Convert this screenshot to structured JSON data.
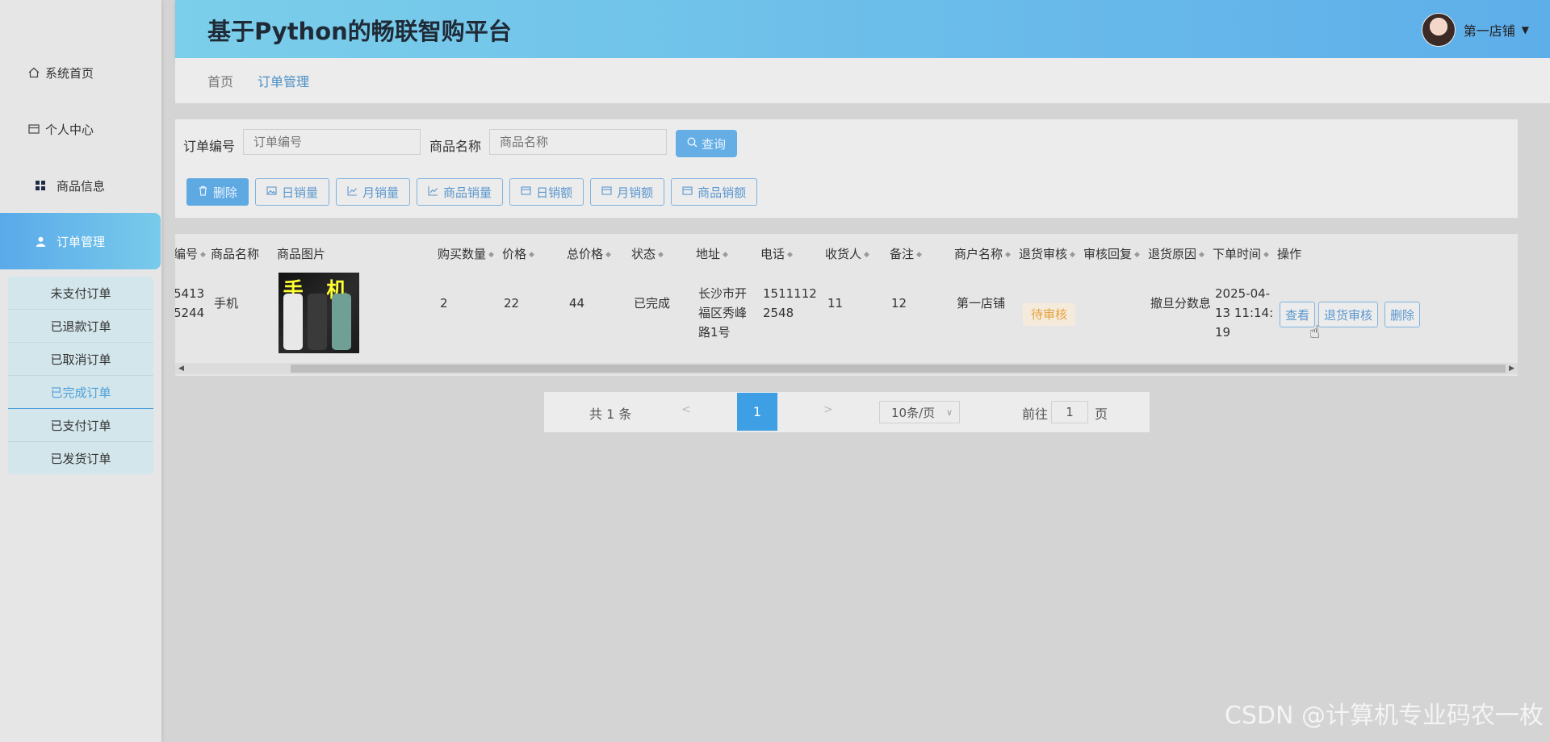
{
  "app": {
    "title": "基于Python的畅联智购平台",
    "user": "第一店铺"
  },
  "sidebar": {
    "items": [
      {
        "label": "系统首页",
        "icon": "home-icon"
      },
      {
        "label": "个人中心",
        "icon": "profile-card-icon"
      },
      {
        "label": "商品信息",
        "icon": "grid-icon"
      },
      {
        "label": "订单管理",
        "icon": "user-icon"
      }
    ],
    "subitems": [
      "未支付订单",
      "已退款订单",
      "已取消订单",
      "已完成订单",
      "已支付订单",
      "已发货订单"
    ]
  },
  "breadcrumb": {
    "home": "首页",
    "current": "订单管理"
  },
  "search": {
    "order_no_label": "订单编号",
    "order_no_placeholder": "订单编号",
    "product_label": "商品名称",
    "product_placeholder": "商品名称",
    "query_label": "查询"
  },
  "toolbar": [
    "删除",
    "日销量",
    "月销量",
    "商品销量",
    "日销额",
    "月销额",
    "商品销额"
  ],
  "table": {
    "headers": [
      "编号",
      "商品名称",
      "商品图片",
      "购买数量",
      "价格",
      "总价格",
      "状态",
      "地址",
      "电话",
      "收货人",
      "备注",
      "商户名称",
      "退货审核",
      "审核回复",
      "退货原因",
      "下单时间",
      "操作"
    ],
    "row": {
      "order_no_l1": "5413",
      "order_no_l2": "5244",
      "product": "手机",
      "image_text": "手 机",
      "qty": "2",
      "price": "22",
      "total": "44",
      "status": "已完成",
      "address_l1": "长沙市开",
      "address_l2": "福区秀峰",
      "address_l3": "路1号",
      "phone_l1": "1511112",
      "phone_l2": "2548",
      "receiver": "11",
      "note": "12",
      "merchant": "第一店铺",
      "return_review": "待审核",
      "return_reason": "撤旦分数息",
      "time_l1": "2025-04-",
      "time_l2": "13 11:14:",
      "time_l3": "19",
      "actions": [
        "查看",
        "退货审核",
        "删除"
      ]
    }
  },
  "pager": {
    "total": "共 1 条",
    "prev": "<",
    "page": "1",
    "next": ">",
    "size": "10条/页",
    "goto": "前往",
    "goto_value": "1",
    "unit": "页"
  },
  "watermark": "CSDN @计算机专业码农一枚"
}
